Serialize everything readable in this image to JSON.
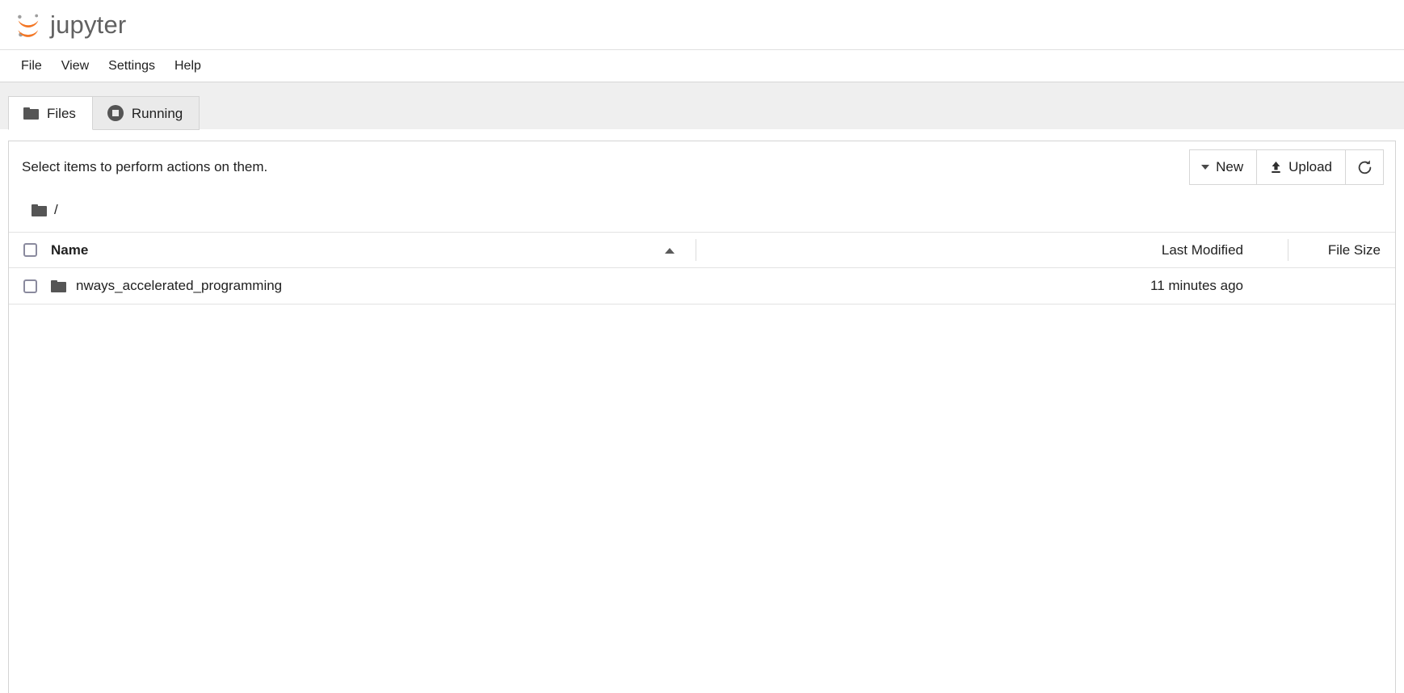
{
  "brand": {
    "name": "jupyter",
    "logo_icon": "jupyter-logo-icon",
    "logo_color": "#f37726",
    "wordmark_color": "#616161"
  },
  "menu": {
    "items": [
      {
        "label": "File"
      },
      {
        "label": "View"
      },
      {
        "label": "Settings"
      },
      {
        "label": "Help"
      }
    ]
  },
  "tabs": [
    {
      "label": "Files",
      "icon": "folder-icon",
      "active": true
    },
    {
      "label": "Running",
      "icon": "stop-circle-icon",
      "active": false
    }
  ],
  "toolbar": {
    "select_hint": "Select items to perform actions on them.",
    "new_label": "New",
    "new_icon": "caret-down-icon",
    "upload_label": "Upload",
    "upload_icon": "upload-icon",
    "refresh_icon": "refresh-icon",
    "refresh_label": ""
  },
  "breadcrumb": {
    "root_icon": "folder-icon",
    "separator": "/"
  },
  "table": {
    "columns": {
      "name": "Name",
      "last_modified": "Last Modified",
      "file_size": "File Size"
    },
    "sort": {
      "column": "Name",
      "direction": "ascending",
      "icon": "caret-up-icon"
    },
    "rows": [
      {
        "name": "nways_accelerated_programming",
        "icon": "folder-icon",
        "last_modified": "11 minutes ago",
        "file_size": ""
      }
    ]
  }
}
